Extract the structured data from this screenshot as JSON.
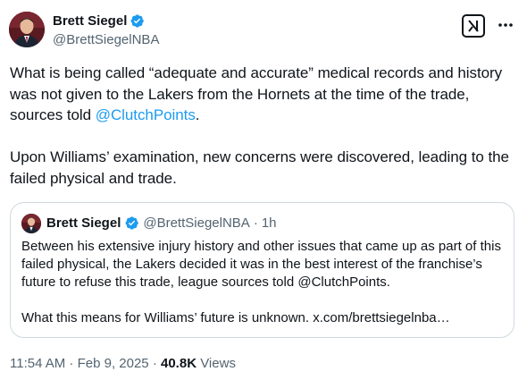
{
  "author": {
    "display_name": "Brett Siegel",
    "handle": "@BrettSiegelNBA",
    "verified": true
  },
  "header_actions": [
    "grok-icon",
    "more-icon"
  ],
  "tweet": {
    "paragraph1_before": "What is being called “adequate and accurate” medical records and history was not given to the Lakers from the Hornets at the time of the trade, sources told ",
    "paragraph1_mention": "@ClutchPoints",
    "paragraph1_after": ".",
    "paragraph2": "Upon Williams’ examination, new concerns were discovered, leading to the failed physical and trade."
  },
  "quoted_tweet": {
    "display_name": "Brett Siegel",
    "handle": "@BrettSiegelNBA",
    "separator": "·",
    "age": "1h",
    "paragraph1": "Between his extensive injury history and other issues that came up as part of this failed physical, the Lakers decided it was in the best interest of the franchise’s future to refuse this trade, league sources told @ClutchPoints.",
    "paragraph2": "What this means for Williams’ future is unknown. x.com/brettsiegelnba…"
  },
  "footer": {
    "timestamp": "11:54 AM · Feb 9, 2025 ·",
    "views_count": "40.8K",
    "views_label": "Views"
  },
  "colors": {
    "link": "#1d9bf0",
    "verified_badge": "#1d9bf0",
    "secondary_text": "#536471",
    "border": "#cfd9de"
  }
}
